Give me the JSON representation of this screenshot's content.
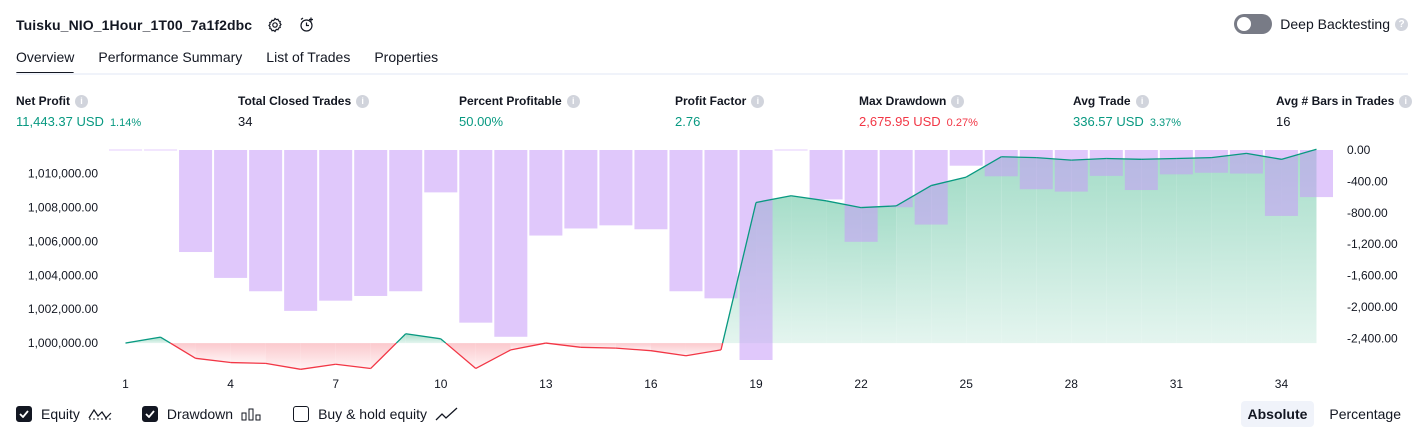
{
  "header": {
    "title": "Tuisku_NIO_1Hour_1T00_7a1f2dbc",
    "settings_icon": "gear-icon",
    "alert_icon": "alarm-add-icon"
  },
  "deep_backtesting": {
    "label": "Deep Backtesting",
    "enabled": false
  },
  "tabs": [
    {
      "label": "Overview",
      "active": true
    },
    {
      "label": "Performance Summary",
      "active": false
    },
    {
      "label": "List of Trades",
      "active": false
    },
    {
      "label": "Properties",
      "active": false
    }
  ],
  "metrics": {
    "net_profit": {
      "label": "Net Profit",
      "value": "11,443.37 USD",
      "sub": "1.14%"
    },
    "total_closed_trades": {
      "label": "Total Closed Trades",
      "value": "34"
    },
    "percent_profitable": {
      "label": "Percent Profitable",
      "value": "50.00%"
    },
    "profit_factor": {
      "label": "Profit Factor",
      "value": "2.76"
    },
    "max_drawdown": {
      "label": "Max Drawdown",
      "value": "2,675.95 USD",
      "sub": "0.27%"
    },
    "avg_trade": {
      "label": "Avg Trade",
      "value": "336.57 USD",
      "sub": "3.37%"
    },
    "avg_bars": {
      "label": "Avg # Bars in Trades",
      "value": "16"
    }
  },
  "colors": {
    "positive": "#089981",
    "negative": "#f23645",
    "drawdown_bar": "#e1c5fc",
    "equity_fill": "#c8eadf",
    "drawdown_fill": "#fcd4d6"
  },
  "chart_data": {
    "type": "area",
    "x": [
      1,
      2,
      3,
      4,
      5,
      6,
      7,
      8,
      9,
      10,
      11,
      12,
      13,
      14,
      15,
      16,
      17,
      18,
      19,
      20,
      21,
      22,
      23,
      24,
      25,
      26,
      27,
      28,
      29,
      30,
      31,
      32,
      33,
      34,
      35
    ],
    "x_ticks": [
      "1",
      "4",
      "7",
      "10",
      "13",
      "16",
      "19",
      "22",
      "25",
      "28",
      "31",
      "34"
    ],
    "y_left_ticks": [
      "1,010,000.00",
      "1,008,000.00",
      "1,006,000.00",
      "1,004,000.00",
      "1,002,000.00",
      "1,000,000.00"
    ],
    "y_right_ticks": [
      "0.00",
      "-400.00",
      "-800.00",
      "-1,200.00",
      "-1,600.00",
      "-2,000.00",
      "-2,400.00"
    ],
    "y_left_range": [
      999000,
      1011400
    ],
    "y_right_range": [
      -2675.95,
      0
    ],
    "series": [
      {
        "name": "Equity",
        "axis": "left",
        "values": [
          1000000,
          1000350,
          999100,
          998850,
          998800,
          998450,
          998750,
          998500,
          1000550,
          1000250,
          998500,
          999600,
          1000000,
          999750,
          999700,
          999550,
          999250,
          999600,
          1008300,
          1008700,
          1008400,
          1008000,
          1008100,
          1009300,
          1009800,
          1011000,
          1010950,
          1010800,
          1010900,
          1010850,
          1010900,
          1010950,
          1011200,
          1010850,
          1011443
        ]
      },
      {
        "name": "Drawdown",
        "axis": "right",
        "values": [
          0,
          0,
          -1300,
          -1630,
          -1800,
          -2050,
          -1920,
          -1860,
          -1800,
          -540,
          -2200,
          -2380,
          -1090,
          -1000,
          -960,
          -1010,
          -1800,
          -1890,
          -2675.95,
          0,
          -630,
          -1170,
          -730,
          -950,
          -200,
          -335,
          -500,
          -530,
          -330,
          -510,
          -310,
          -290,
          -300,
          -840,
          -600
        ]
      }
    ]
  },
  "legend": {
    "equity": {
      "label": "Equity",
      "checked": true,
      "icon": "equity-line-icon"
    },
    "drawdown": {
      "label": "Drawdown",
      "checked": true,
      "icon": "bars-icon"
    },
    "buy_hold": {
      "label": "Buy & hold equity",
      "checked": false,
      "icon": "trend-line-icon"
    }
  },
  "modes": {
    "absolute": "Absolute",
    "percentage": "Percentage",
    "selected": "Absolute"
  }
}
